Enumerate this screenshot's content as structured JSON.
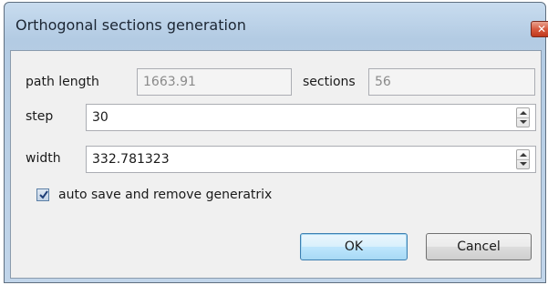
{
  "window": {
    "title": "Orthogonal sections generation",
    "close_icon": "close-icon"
  },
  "path_length": {
    "label": "path length",
    "value": "1663.91"
  },
  "sections": {
    "label": "sections",
    "value": "56"
  },
  "step": {
    "label": "step",
    "value": "30"
  },
  "width": {
    "label": "width",
    "value": "332.781323"
  },
  "auto_save": {
    "label": "auto save and remove generatrix",
    "checked": true
  },
  "buttons": {
    "ok": "OK",
    "cancel": "Cancel"
  },
  "colors": {
    "title_bar": "#b9d0e8",
    "client_bg": "#f0f0f0",
    "close_button": "#c7452a"
  }
}
